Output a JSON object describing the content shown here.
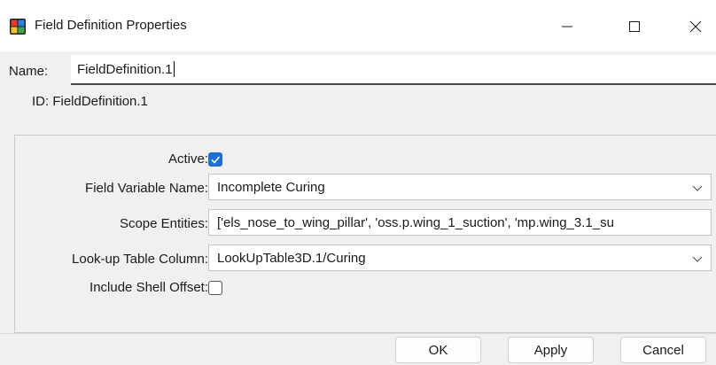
{
  "window": {
    "title": "Field Definition Properties",
    "minimize_glyph": "—",
    "maximize_glyph": "☐",
    "close_glyph": "✕"
  },
  "name": {
    "label": "Name:",
    "value": "FieldDefinition.1"
  },
  "id": {
    "text": "ID: FieldDefinition.1"
  },
  "properties": {
    "active_label": "Active:",
    "active_checked": true,
    "field_variable_label": "Field Variable Name:",
    "field_variable_value": "Incomplete Curing",
    "scope_label": "Scope Entities:",
    "scope_value": "['els_nose_to_wing_pillar', 'oss.p.wing_1_suction', 'mp.wing_3.1_su",
    "lookup_label": "Look-up Table Column:",
    "lookup_value": "LookUpTable3D.1/Curing",
    "shell_offset_label": "Include Shell Offset:",
    "shell_offset_checked": false
  },
  "buttons": {
    "ok": "OK",
    "apply": "Apply",
    "cancel": "Cancel"
  },
  "colors": {
    "accent": "#1f6fd1",
    "background": "#f0f0f0",
    "titlebar": "#ffffff"
  },
  "icons": {
    "app": "app-grid-icon",
    "dropdown": "chevron-down-icon",
    "check": "check-icon"
  }
}
